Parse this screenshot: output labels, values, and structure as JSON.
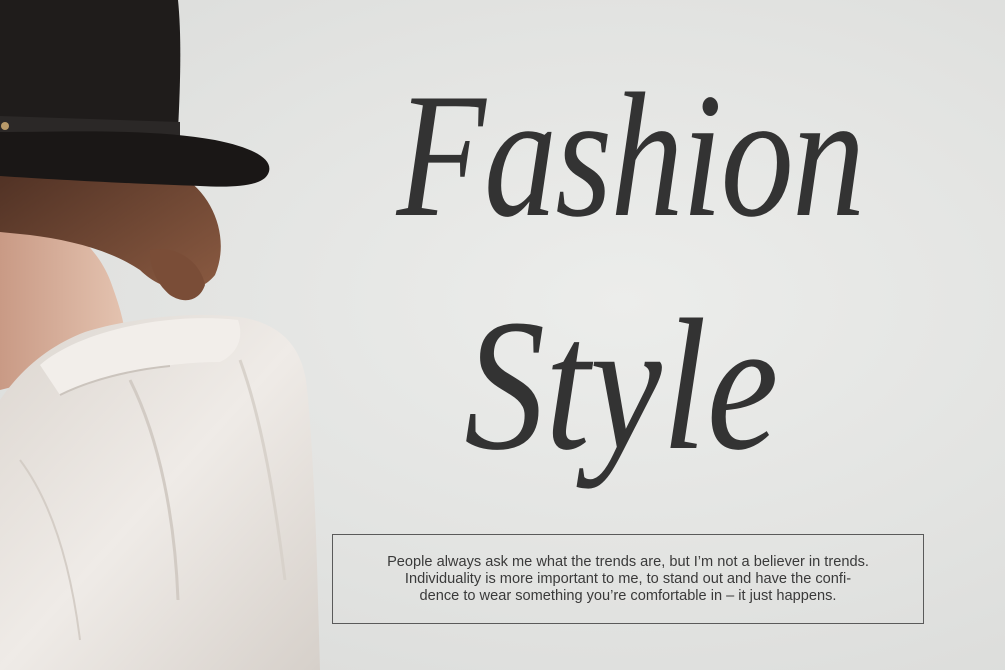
{
  "headline": {
    "line1": "Fashion",
    "line2": "Style"
  },
  "quote": {
    "lines": [
      "People always ask me what the trends are, but I’m not a believer in trends.",
      "Individuality is more important to me, to stand out and have the confi-",
      "dence to wear something you’re comfortable in – it just happens."
    ]
  },
  "colors": {
    "background": "#e4e4e2",
    "headline_text": "#333333",
    "quote_text": "#3a3a3a",
    "box_border": "#5a5a5a",
    "hat": "#1f1c1b",
    "shirt": "#ebe6e1",
    "hair": "#6e4632",
    "skin": "#d9b5a0"
  },
  "image": {
    "subject": "woman-in-black-hat-and-white-shirt-photo"
  }
}
